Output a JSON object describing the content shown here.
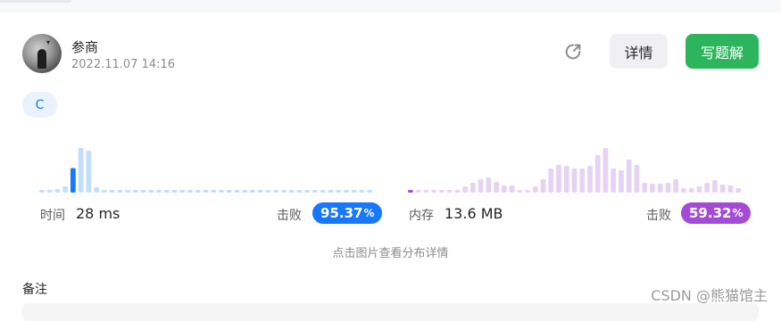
{
  "header": {
    "username": "参商",
    "timestamp": "2022.11.07 14:16",
    "share_icon": "share-icon",
    "details_label": "详情",
    "write_solution_label": "写题解"
  },
  "language_tag": "C",
  "runtime": {
    "label": "时间",
    "value": "28 ms",
    "beat_label": "击败",
    "beat_number": "95.37",
    "beat_unit": "%",
    "accent_color": "#1677ff",
    "bar_color": "#c3def8",
    "histogram": [
      0.04,
      0.04,
      0.08,
      0.14,
      0.55,
      1.0,
      0.94,
      0.12,
      0.06,
      0.04,
      0.04,
      0.04,
      0.04,
      0.04,
      0.04,
      0.04,
      0.04,
      0.04,
      0.04,
      0.04,
      0.04,
      0.04,
      0.04,
      0.04,
      0.04,
      0.04,
      0.04,
      0.04,
      0.04,
      0.04,
      0.04,
      0.04,
      0.04,
      0.04,
      0.04,
      0.04,
      0.04,
      0.04,
      0.04,
      0.04,
      0.04,
      0.04,
      0.04
    ],
    "highlight_index": 4
  },
  "memory": {
    "label": "内存",
    "value": "13.6 MB",
    "beat_label": "击败",
    "beat_number": "59.32",
    "beat_unit": "%",
    "accent_color": "#a54ad6",
    "bar_color": "#e6d3f3",
    "histogram": [
      0.06,
      0.06,
      0.06,
      0.06,
      0.06,
      0.06,
      0.06,
      0.14,
      0.22,
      0.3,
      0.34,
      0.24,
      0.16,
      0.16,
      0.06,
      0.06,
      0.14,
      0.3,
      0.54,
      0.62,
      0.6,
      0.54,
      0.54,
      0.6,
      0.84,
      1.0,
      0.54,
      0.5,
      0.74,
      0.62,
      0.22,
      0.2,
      0.2,
      0.22,
      0.3,
      0.1,
      0.1,
      0.14,
      0.22,
      0.28,
      0.18,
      0.16,
      0.1
    ],
    "highlight_index": 0
  },
  "hint_text": "点击图片查看分布详情",
  "notes_label": "备注",
  "watermark": "CSDN @熊猫馆主"
}
